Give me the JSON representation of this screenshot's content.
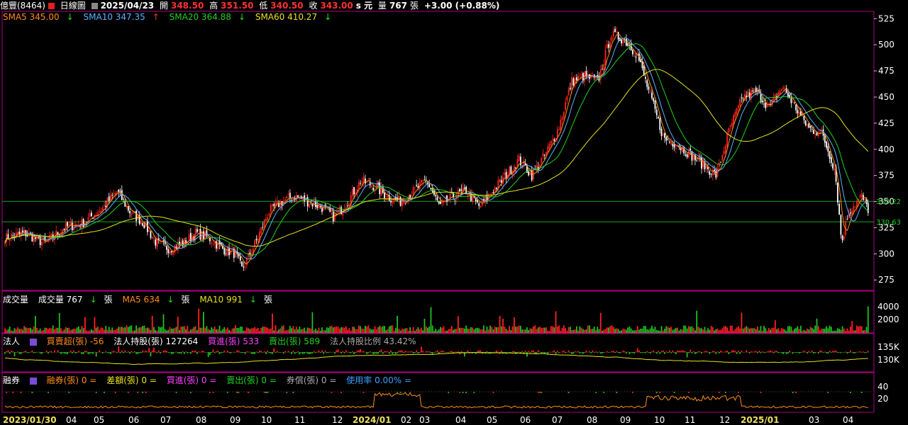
{
  "header": {
    "stock_name": "億豐(8464)",
    "period": "日線圖",
    "date": "2025/04/23",
    "open_label": "開",
    "open": "348.50",
    "high_label": "高",
    "high": "351.50",
    "low_label": "低",
    "low": "340.50",
    "close_label": "收",
    "close": "343.00",
    "close_suffix": "s 元",
    "volume_label": "量",
    "volume": "767",
    "volume_unit": "張",
    "change": "+3.00 (+0.88%)"
  },
  "price_legend": {
    "sma5": "SMA5 345.00",
    "sma10": "SMA10 347.35",
    "sma20": "SMA20 364.88",
    "sma60": "SMA60 410.27"
  },
  "volume_legend": {
    "title": "成交量",
    "vol": "成交量 767",
    "unit": "張",
    "ma5": "MA5 634",
    "ma10": "MA10 991"
  },
  "inst_legend": {
    "title": "法人",
    "net": "買賣超(張) -56",
    "holding": "法人持股(張) 127264",
    "buy": "買進(張) 533",
    "sell": "賣出(張) 589",
    "ratio": "法人持股比例 43.42%"
  },
  "margin_legend": {
    "title": "融券",
    "short": "融券(張) 0 =",
    "diff": "差額(張) 0 =",
    "buy": "買進(張) 0 =",
    "sell": "賣出(張) 0 =",
    "repay": "券償(張) 0 =",
    "usage": "使用率 0.00% ="
  },
  "colors": {
    "up": "#ff2020",
    "down": "#ffffff",
    "sma5": "#ff8c1a",
    "sma10": "#5ab4ff",
    "sma20": "#20d020",
    "sma60": "#e8e020",
    "frame": "#b00080",
    "refline": "#20a020"
  },
  "chart_data": {
    "type": "candlestick",
    "price_axis_ticks": [
      275,
      300,
      325,
      350,
      375,
      400,
      425,
      450,
      475,
      500,
      525
    ],
    "price_ylim": [
      265,
      532
    ],
    "reference_lines": [
      "350.22",
      "330.63"
    ],
    "volume_axis_ticks": [
      "4000",
      "2000"
    ],
    "inst_axis_ticks": [
      "135K",
      "130K"
    ],
    "margin_axis_ticks": [
      "40",
      "20"
    ],
    "x_labels": [
      "2023/01/30",
      "04",
      "05",
      "06",
      "07",
      "08",
      "09",
      "10",
      "11",
      "12",
      "2024/01",
      "02",
      "03",
      "04",
      "05",
      "06",
      "07",
      "08",
      "09",
      "10",
      "11",
      "12",
      "2025/01",
      "03",
      "04"
    ],
    "price_path": [
      [
        0,
        315
      ],
      [
        3,
        320
      ],
      [
        6,
        310
      ],
      [
        9,
        325
      ],
      [
        12,
        330
      ],
      [
        15,
        345
      ],
      [
        17,
        360
      ],
      [
        19,
        340
      ],
      [
        21,
        330
      ],
      [
        23,
        310
      ],
      [
        25,
        305
      ],
      [
        27,
        310
      ],
      [
        29,
        320
      ],
      [
        31,
        315
      ],
      [
        33,
        305
      ],
      [
        35,
        300
      ],
      [
        36,
        285
      ],
      [
        38,
        310
      ],
      [
        40,
        340
      ],
      [
        42,
        350
      ],
      [
        44,
        355
      ],
      [
        46,
        350
      ],
      [
        48,
        345
      ],
      [
        50,
        335
      ],
      [
        52,
        350
      ],
      [
        54,
        370
      ],
      [
        56,
        365
      ],
      [
        58,
        355
      ],
      [
        60,
        350
      ],
      [
        62,
        360
      ],
      [
        64,
        370
      ],
      [
        66,
        345
      ],
      [
        68,
        355
      ],
      [
        70,
        360
      ],
      [
        72,
        345
      ],
      [
        74,
        360
      ],
      [
        76,
        375
      ],
      [
        78,
        390
      ],
      [
        80,
        375
      ],
      [
        82,
        395
      ],
      [
        84,
        420
      ],
      [
        86,
        465
      ],
      [
        88,
        470
      ],
      [
        90,
        465
      ],
      [
        92,
        510
      ],
      [
        94,
        505
      ],
      [
        96,
        490
      ],
      [
        98,
        450
      ],
      [
        100,
        410
      ],
      [
        102,
        405
      ],
      [
        104,
        395
      ],
      [
        106,
        385
      ],
      [
        108,
        375
      ],
      [
        110,
        420
      ],
      [
        112,
        450
      ],
      [
        114,
        455
      ],
      [
        116,
        440
      ],
      [
        118,
        460
      ],
      [
        120,
        440
      ],
      [
        122,
        420
      ],
      [
        124,
        415
      ],
      [
        126,
        380
      ],
      [
        127,
        310
      ],
      [
        128,
        340
      ],
      [
        130,
        355
      ],
      [
        131,
        343
      ]
    ]
  }
}
